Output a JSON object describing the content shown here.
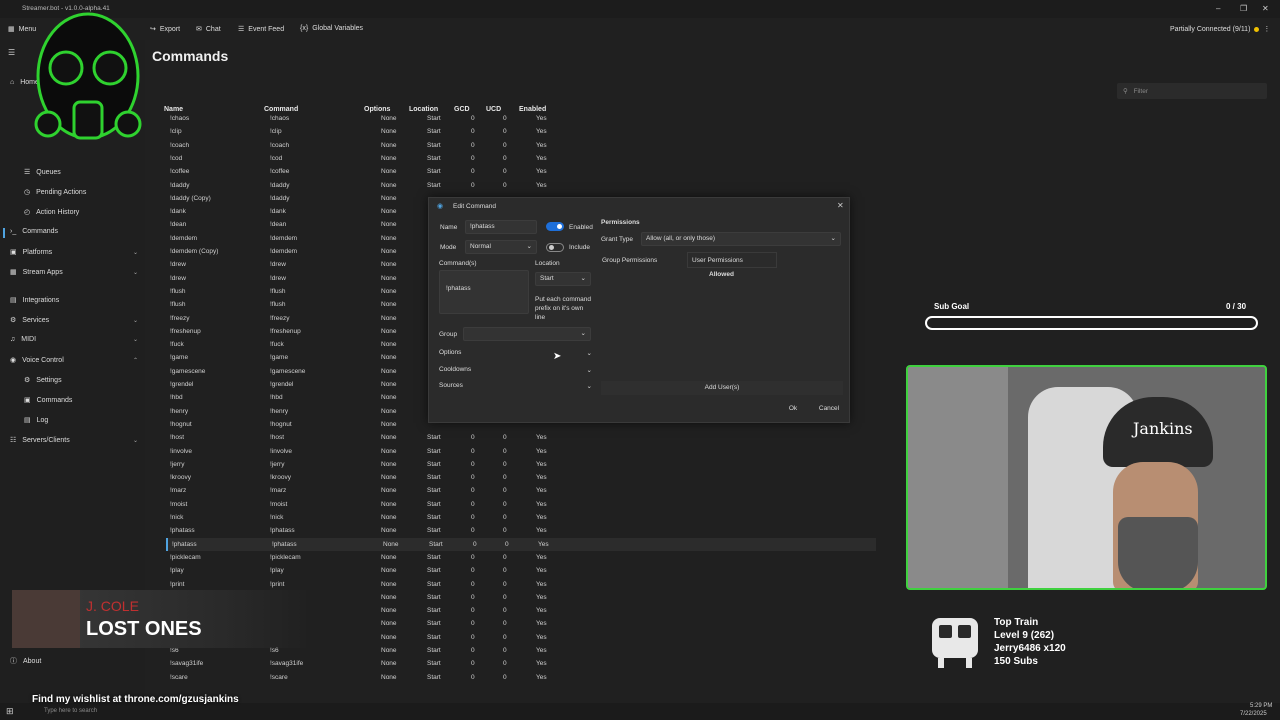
{
  "window": {
    "title": "Streamer.bot - v1.0.0-alpha.41",
    "status": "Partially Connected (9/11)"
  },
  "toolbar": {
    "menu": "Menu",
    "export": "Export",
    "chat": "Chat",
    "event_feed": "Event Feed",
    "global_variables": "Global Variables"
  },
  "sidebar": {
    "items": [
      {
        "label": "Home"
      },
      {
        "label": "Queues"
      },
      {
        "label": "Pending Actions"
      },
      {
        "label": "Action History"
      },
      {
        "label": "Commands"
      },
      {
        "label": "Platforms"
      },
      {
        "label": "Stream Apps"
      },
      {
        "label": "Integrations"
      },
      {
        "label": "Services"
      },
      {
        "label": "MIDI"
      },
      {
        "label": "Voice Control"
      },
      {
        "label": "Settings"
      },
      {
        "label": "Commands"
      },
      {
        "label": "Log"
      },
      {
        "label": "Servers/Clients"
      },
      {
        "label": "About"
      }
    ]
  },
  "page": {
    "title": "Commands",
    "filter_placeholder": "Filter"
  },
  "table": {
    "headers": {
      "name": "Name",
      "command": "Command",
      "options": "Options",
      "location": "Location",
      "gcd": "GCD",
      "ucd": "UCD",
      "enabled": "Enabled"
    },
    "rows": [
      {
        "name": "!chaos",
        "command": "!chaos",
        "options": "None",
        "location": "Start",
        "gcd": "0",
        "ucd": "0",
        "enabled": "Yes"
      },
      {
        "name": "!clip",
        "command": "!clip",
        "options": "None",
        "location": "Start",
        "gcd": "0",
        "ucd": "0",
        "enabled": "Yes"
      },
      {
        "name": "!coach",
        "command": "!coach",
        "options": "None",
        "location": "Start",
        "gcd": "0",
        "ucd": "0",
        "enabled": "Yes"
      },
      {
        "name": "!cod",
        "command": "!cod",
        "options": "None",
        "location": "Start",
        "gcd": "0",
        "ucd": "0",
        "enabled": "Yes"
      },
      {
        "name": "!coffee",
        "command": "!coffee",
        "options": "None",
        "location": "Start",
        "gcd": "0",
        "ucd": "0",
        "enabled": "Yes"
      },
      {
        "name": "!daddy",
        "command": "!daddy",
        "options": "None",
        "location": "Start",
        "gcd": "0",
        "ucd": "0",
        "enabled": "Yes"
      },
      {
        "name": "!daddy (Copy)",
        "command": "!daddy",
        "options": "None",
        "location": "",
        "gcd": "",
        "ucd": "",
        "enabled": ""
      },
      {
        "name": "!dank",
        "command": "!dank",
        "options": "None",
        "location": "",
        "gcd": "",
        "ucd": "",
        "enabled": ""
      },
      {
        "name": "!dean",
        "command": "!dean",
        "options": "None",
        "location": "",
        "gcd": "",
        "ucd": "",
        "enabled": ""
      },
      {
        "name": "!demdem",
        "command": "!demdem",
        "options": "None",
        "location": "",
        "gcd": "",
        "ucd": "",
        "enabled": ""
      },
      {
        "name": "!demdem (Copy)",
        "command": "!demdem",
        "options": "None",
        "location": "",
        "gcd": "",
        "ucd": "",
        "enabled": ""
      },
      {
        "name": "!drew",
        "command": "!drew",
        "options": "None",
        "location": "",
        "gcd": "",
        "ucd": "",
        "enabled": ""
      },
      {
        "name": "!drew",
        "command": "!drew",
        "options": "None",
        "location": "",
        "gcd": "",
        "ucd": "",
        "enabled": ""
      },
      {
        "name": "!flush",
        "command": "!flush",
        "options": "None",
        "location": "",
        "gcd": "",
        "ucd": "",
        "enabled": ""
      },
      {
        "name": "!flush",
        "command": "!flush",
        "options": "None",
        "location": "",
        "gcd": "",
        "ucd": "",
        "enabled": ""
      },
      {
        "name": "!freezy",
        "command": "!freezy",
        "options": "None",
        "location": "",
        "gcd": "",
        "ucd": "",
        "enabled": ""
      },
      {
        "name": "!freshenup",
        "command": "!freshenup",
        "options": "None",
        "location": "",
        "gcd": "",
        "ucd": "",
        "enabled": ""
      },
      {
        "name": "!fuck",
        "command": "!fuck",
        "options": "None",
        "location": "",
        "gcd": "",
        "ucd": "",
        "enabled": ""
      },
      {
        "name": "!game",
        "command": "!game",
        "options": "None",
        "location": "",
        "gcd": "",
        "ucd": "",
        "enabled": ""
      },
      {
        "name": "!gamescene",
        "command": "!gamescene",
        "options": "None",
        "location": "",
        "gcd": "",
        "ucd": "",
        "enabled": ""
      },
      {
        "name": "!grendel",
        "command": "!grendel",
        "options": "None",
        "location": "",
        "gcd": "",
        "ucd": "",
        "enabled": ""
      },
      {
        "name": "!hbd",
        "command": "!hbd",
        "options": "None",
        "location": "",
        "gcd": "",
        "ucd": "",
        "enabled": ""
      },
      {
        "name": "!henry",
        "command": "!henry",
        "options": "None",
        "location": "",
        "gcd": "",
        "ucd": "",
        "enabled": ""
      },
      {
        "name": "!hognut",
        "command": "!hognut",
        "options": "None",
        "location": "",
        "gcd": "",
        "ucd": "",
        "enabled": ""
      },
      {
        "name": "!host",
        "command": "!host",
        "options": "None",
        "location": "Start",
        "gcd": "0",
        "ucd": "0",
        "enabled": "Yes"
      },
      {
        "name": "!involve",
        "command": "!involve",
        "options": "None",
        "location": "Start",
        "gcd": "0",
        "ucd": "0",
        "enabled": "Yes"
      },
      {
        "name": "!jerry",
        "command": "!jerry",
        "options": "None",
        "location": "Start",
        "gcd": "0",
        "ucd": "0",
        "enabled": "Yes"
      },
      {
        "name": "!kroovy",
        "command": "!kroovy",
        "options": "None",
        "location": "Start",
        "gcd": "0",
        "ucd": "0",
        "enabled": "Yes"
      },
      {
        "name": "!marz",
        "command": "!marz",
        "options": "None",
        "location": "Start",
        "gcd": "0",
        "ucd": "0",
        "enabled": "Yes"
      },
      {
        "name": "!moist",
        "command": "!moist",
        "options": "None",
        "location": "Start",
        "gcd": "0",
        "ucd": "0",
        "enabled": "Yes"
      },
      {
        "name": "!nick",
        "command": "!nick",
        "options": "None",
        "location": "Start",
        "gcd": "0",
        "ucd": "0",
        "enabled": "Yes"
      },
      {
        "name": "!phatass",
        "command": "!phatass",
        "options": "None",
        "location": "Start",
        "gcd": "0",
        "ucd": "0",
        "enabled": "Yes"
      },
      {
        "name": "!phatass",
        "command": "!phatass",
        "options": "None",
        "location": "Start",
        "gcd": "0",
        "ucd": "0",
        "enabled": "Yes"
      },
      {
        "name": "!picklecam",
        "command": "!picklecam",
        "options": "None",
        "location": "Start",
        "gcd": "0",
        "ucd": "0",
        "enabled": "Yes"
      },
      {
        "name": "!play",
        "command": "!play",
        "options": "None",
        "location": "Start",
        "gcd": "0",
        "ucd": "0",
        "enabled": "Yes"
      },
      {
        "name": "!print",
        "command": "!print",
        "options": "None",
        "location": "Start",
        "gcd": "0",
        "ucd": "0",
        "enabled": "Yes"
      },
      {
        "name": "",
        "command": "",
        "options": "None",
        "location": "Start",
        "gcd": "0",
        "ucd": "0",
        "enabled": "Yes"
      },
      {
        "name": "",
        "command": "",
        "options": "None",
        "location": "Start",
        "gcd": "0",
        "ucd": "0",
        "enabled": "Yes"
      },
      {
        "name": "",
        "command": "",
        "options": "None",
        "location": "Start",
        "gcd": "0",
        "ucd": "0",
        "enabled": "Yes"
      },
      {
        "name": "",
        "command": "",
        "options": "None",
        "location": "Start",
        "gcd": "0",
        "ucd": "0",
        "enabled": "Yes"
      },
      {
        "name": "!s6",
        "command": "!s6",
        "options": "None",
        "location": "Start",
        "gcd": "0",
        "ucd": "0",
        "enabled": "Yes"
      },
      {
        "name": "!savag31ife",
        "command": "!savag31ife",
        "options": "None",
        "location": "Start",
        "gcd": "0",
        "ucd": "0",
        "enabled": "Yes"
      },
      {
        "name": "!scare",
        "command": "!scare",
        "options": "None",
        "location": "Start",
        "gcd": "0",
        "ucd": "0",
        "enabled": "Yes"
      }
    ]
  },
  "dialog": {
    "title": "Edit Command",
    "name_label": "Name",
    "name_value": "!phatass",
    "enabled_label": "Enabled",
    "mode_label": "Mode",
    "mode_value": "Normal",
    "include_label": "Include",
    "commands_label": "Command(s)",
    "commands_value": "!phatass",
    "location_label": "Location",
    "location_value": "Start",
    "location_hint": "Put each command prefix on it's own line",
    "group_label": "Group",
    "options_label": "Options",
    "cooldowns_label": "Cooldowns",
    "sources_label": "Sources",
    "permissions_title": "Permissions",
    "grant_type_label": "Grant Type",
    "grant_type_value": "Allow (all, or only those)",
    "group_permissions": "Group Permissions",
    "user_permissions": "User Permissions",
    "allowed": "Allowed",
    "add_users": "Add User(s)",
    "ok": "Ok",
    "cancel": "Cancel"
  },
  "overlay": {
    "sub_goal_label": "Sub Goal",
    "sub_goal_count": "0 / 30",
    "sub_goal_progress": 0,
    "music_artist": "J. COLE",
    "music_title": "LOST ONES",
    "wishlist": "Find my wishlist at throne.com/gzusjankins",
    "train_title": "Top Train",
    "train_level": "Level 9  (262)",
    "train_user": "Jerry6486 x120",
    "train_subs": "150 Subs",
    "cap_text": "Jankins"
  },
  "taskbar": {
    "search": "Type here to search",
    "time": "5:29 PM",
    "date": "7/22/2025"
  },
  "colors": {
    "accent": "#1e6fd9",
    "cam_border": "#3fd13f",
    "status_dot": "#f0c000"
  }
}
